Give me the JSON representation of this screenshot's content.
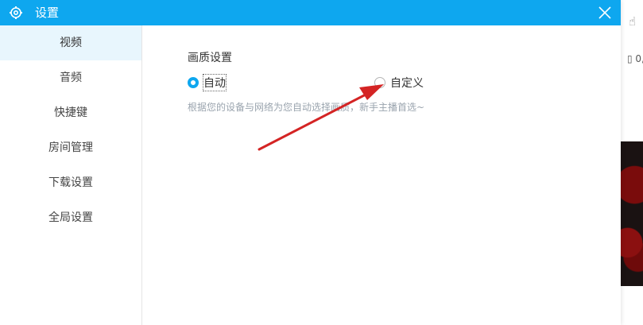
{
  "dialog": {
    "title": "设置",
    "title_icon": "gear-icon",
    "close_icon": "close-icon",
    "accent_color": "#0ea7ef"
  },
  "sidebar": {
    "items": [
      {
        "label": "视频",
        "active": true
      },
      {
        "label": "音频",
        "active": false
      },
      {
        "label": "快捷键",
        "active": false
      },
      {
        "label": "房间管理",
        "active": false
      },
      {
        "label": "下载设置",
        "active": false
      },
      {
        "label": "全局设置",
        "active": false
      }
    ]
  },
  "content": {
    "section_title": "画质设置",
    "options": [
      {
        "label": "自动",
        "checked": true
      },
      {
        "label": "自定义",
        "checked": false
      }
    ],
    "hint": "根据您的设备与网络为您自动选择画质，新手主播首选~"
  },
  "background_app": {
    "text": "0,",
    "annotation_color": "#d42424"
  }
}
